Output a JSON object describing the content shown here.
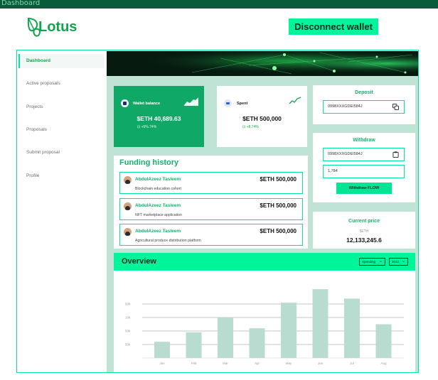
{
  "window": {
    "title": "Dashboard"
  },
  "brand": {
    "name": "Lotus",
    "color": "#12a34f"
  },
  "header": {
    "disconnect_label": "Disconnect wallet"
  },
  "sidebar": {
    "items": [
      {
        "label": "Dashboard",
        "active": true
      },
      {
        "label": "Active proposals"
      },
      {
        "label": "Projects"
      },
      {
        "label": "Proposals"
      },
      {
        "label": "Submit proposal"
      },
      {
        "label": "Profile"
      }
    ]
  },
  "wallet": {
    "label": "Wallet balance",
    "amount": "$ETH 40,689.63",
    "change": "+5%.74%"
  },
  "spent": {
    "label": "Spent",
    "amount": "$ETH 500,000",
    "change": "+8.74%"
  },
  "deposit": {
    "title": "Deposit",
    "address": "0998XXXGDEI584J"
  },
  "withdraw": {
    "title": "Withdraw",
    "address": "0998XXXGDEI584J",
    "amount": "1,784",
    "button_label": "Withdraw FLOW"
  },
  "price": {
    "title": "Current price",
    "unit": "$ETH",
    "value": "12,133,245.6"
  },
  "funding": {
    "title": "Funding history",
    "items": [
      {
        "name": "AbdulAzeez Tasleem",
        "amount": "$ETH 500,000",
        "description": "Blockchain education cohort"
      },
      {
        "name": "AbdulAzeez Tasleem",
        "amount": "$ETH 500,000",
        "description": "NFT marketplace application"
      },
      {
        "name": "AbdulAzeez Tasleem",
        "amount": "$ETH 500,000",
        "description": "Agricultural produce distribution platform"
      }
    ]
  },
  "overview": {
    "title": "Overview",
    "filter_metric": "Spending",
    "filter_year": "2022"
  },
  "chart_data": {
    "type": "bar",
    "categories": [
      "Jan",
      "Feb",
      "Mar",
      "Apr",
      "May",
      "Jun",
      "Jul",
      "Aug"
    ],
    "values": [
      12,
      19,
      30,
      22,
      41,
      51,
      44,
      25
    ],
    "y_ticks": [
      "50k",
      "10k",
      "50k",
      "50k"
    ],
    "y_tick_values": [
      40,
      30,
      20,
      10
    ],
    "ylim": [
      0,
      50
    ],
    "grid": true,
    "bar_color": "#b8dccf"
  },
  "colors": {
    "accent": "#00f59b",
    "primary": "#10a866",
    "panel": "#bfe3d4"
  }
}
